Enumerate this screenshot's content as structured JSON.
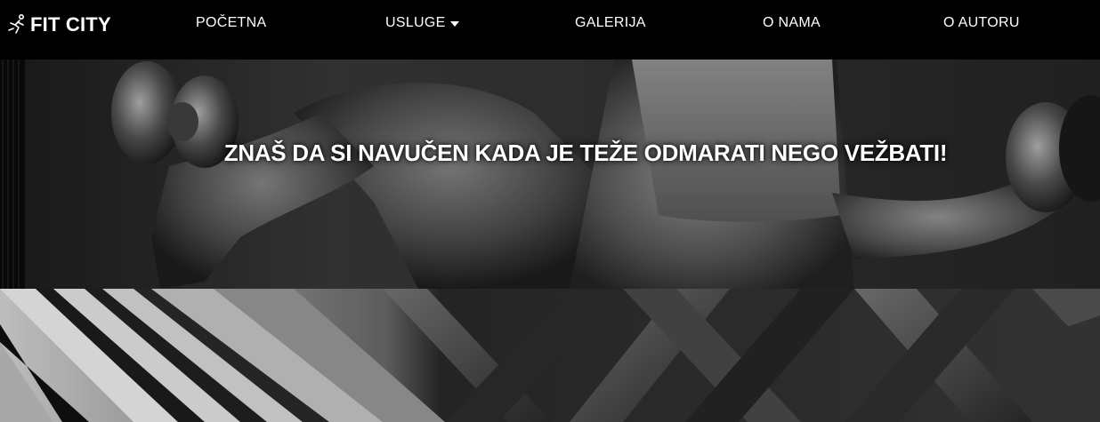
{
  "brand": {
    "name": "FIT CITY",
    "icon": "runner-logo-icon"
  },
  "nav": {
    "items": [
      {
        "label": "POČETNA"
      },
      {
        "label": "USLUGE",
        "has_dropdown": true,
        "icon": "caret-down-icon"
      },
      {
        "label": "GALERIJA"
      },
      {
        "label": "O NAMA"
      },
      {
        "label": "O AUTORU"
      }
    ]
  },
  "hero": {
    "title": "ZNAŠ DA SI NAVUČEN KADA JE TEŽE ODMARATI NEGO VEŽBATI!"
  },
  "colors": {
    "navbar_bg": "#000000",
    "nav_text": "#ffffff",
    "hero_title": "#ffffff"
  }
}
